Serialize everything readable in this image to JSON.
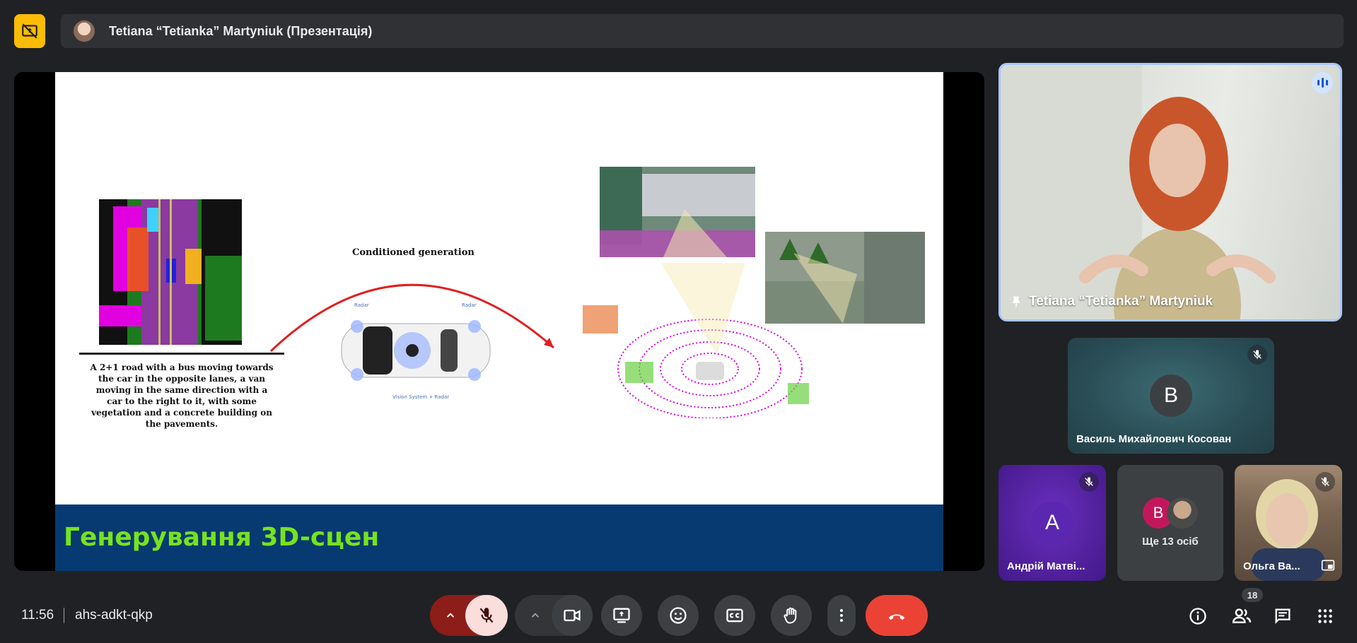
{
  "header": {
    "presenter_title": "Tetiana “Tetianka” Martyniuk (Презентація)"
  },
  "slide": {
    "title": "Генерування 3D-сцен",
    "caption": "A 2+1 road with a bus moving towards the car in the opposite lanes, a van moving in the same direction with a car to the right to it, with some vegetation and a concrete building on the pavements.",
    "arrow_label": "Conditioned generation",
    "sensor_label_left": "Radar",
    "sensor_label_right": "Radar",
    "sensor_label_bottom": "Vision System + Radar"
  },
  "participants": {
    "main": {
      "name": "Tetiana “Tetianka” Martyniuk"
    },
    "tile_v": {
      "initial": "В",
      "name": "Василь Михайлович Косован",
      "avatar_color": "#3c4043"
    },
    "tile_a": {
      "initial": "А",
      "name": "Андрій Матві...",
      "avatar_color": "#5b27b0"
    },
    "tile_more": {
      "initial": "В",
      "label": "Ще 13 осіб",
      "avatar_color": "#c2185b"
    },
    "tile_o": {
      "name": "Ольга Ва..."
    }
  },
  "bottom_bar": {
    "time": "11:56",
    "meeting_code": "ahs-adkt-qkp",
    "participant_count": "18"
  },
  "colors": {
    "accent": "#a8c7fa",
    "end_call": "#ea4335",
    "present_badge": "#fbbc04",
    "mic_off": "#f9dedc"
  }
}
